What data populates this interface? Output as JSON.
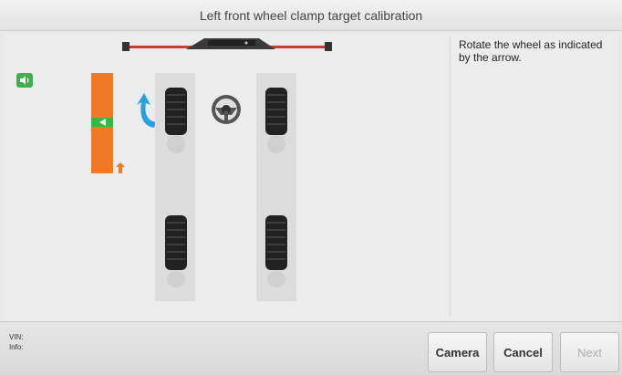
{
  "header": {
    "title": "Left front wheel clamp target calibration"
  },
  "instructions": {
    "text": "Rotate the wheel as indicated by the arrow."
  },
  "footer": {
    "vin_label": "VIN:",
    "info_label": "Info:",
    "camera_label": "Camera",
    "cancel_label": "Cancel",
    "next_label": "Next"
  },
  "icons": {
    "speaker": "speaker-icon",
    "rotate_arrow": "curved-up-arrow-icon",
    "steering_wheel": "steering-wheel-icon",
    "gauge_arrow": "up-arrow-icon",
    "crossbar": "target-crossbar-icon"
  },
  "colors": {
    "gauge_orange": "#f07a24",
    "gauge_green": "#3bb54a",
    "arrow_blue": "#2aa0e0",
    "crossbar_red": "#d13a2f"
  },
  "state": {
    "next_enabled": false
  }
}
